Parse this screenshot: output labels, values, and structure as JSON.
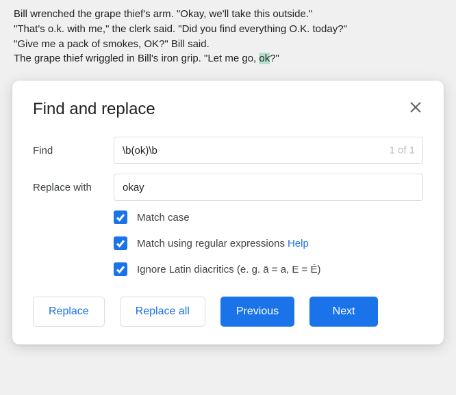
{
  "document": {
    "line1_pre": "Bill wrenched the grape thief's arm. \"Okay, we'll take this outside.\"",
    "line2": "\"That's o.k. with me,\" the clerk said. \"Did you find everything O.K. today?\"",
    "line3": "\"Give me a pack of smokes, OK?\" Bill said.",
    "line4_pre": "The grape thief wriggled in Bill's iron grip. \"Let me go, ",
    "line4_highlight": "ok",
    "line4_post": "?\""
  },
  "dialog": {
    "title": "Find and replace",
    "find_label": "Find",
    "find_value": "\\b(ok)\\b",
    "match_count": "1 of 1",
    "replace_label": "Replace with",
    "replace_value": "okay",
    "options": {
      "match_case": "Match case",
      "regex": "Match using regular expressions",
      "regex_help": "Help",
      "diacritics": "Ignore Latin diacritics (e. g. ä = a, E = É)"
    },
    "buttons": {
      "replace": "Replace",
      "replace_all": "Replace all",
      "previous": "Previous",
      "next": "Next"
    }
  }
}
